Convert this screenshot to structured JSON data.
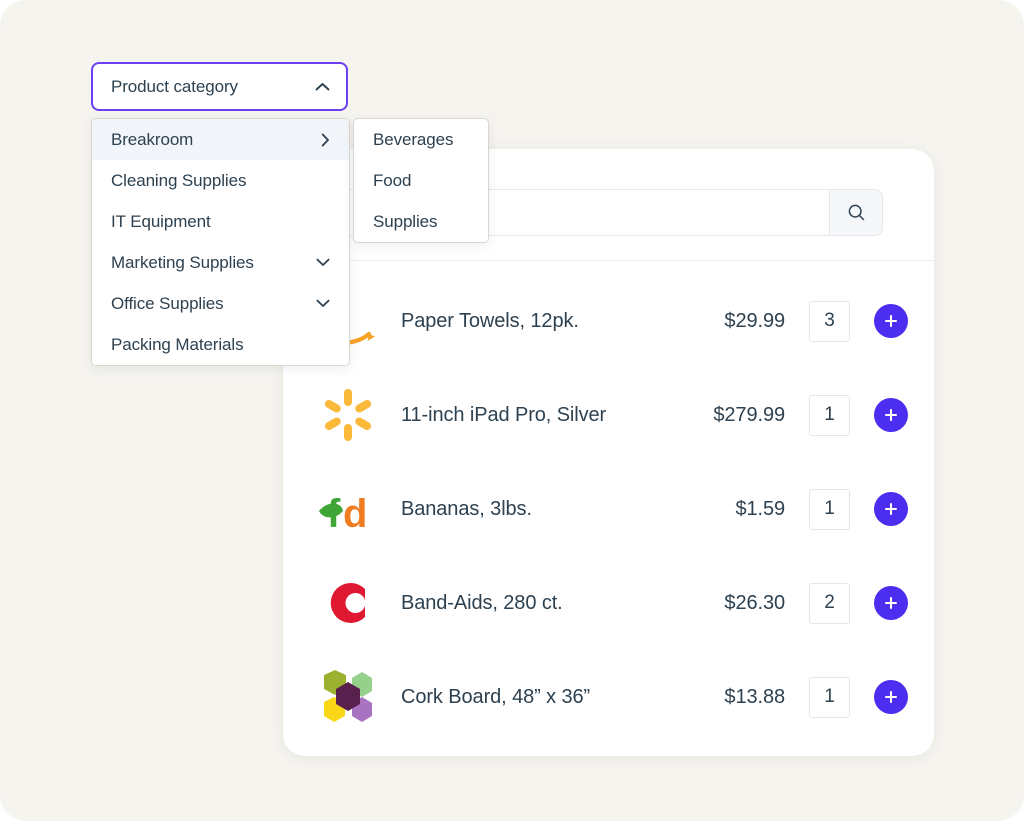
{
  "theme": {
    "page_background": "#f6f4ef",
    "card_background": "#ffffff",
    "accent": "#4b2eef",
    "focus_border": "#6c3ff0",
    "text": "#2d4150",
    "menu_highlight": "#f2f5f9"
  },
  "category_dropdown": {
    "label": "Product category",
    "expanded": true,
    "chevron_icon": "chevron-up-icon",
    "items": [
      {
        "label": "Breakroom",
        "affordance": "chevron-right-icon",
        "highlighted": true
      },
      {
        "label": "Cleaning Supplies",
        "affordance": "",
        "highlighted": false
      },
      {
        "label": "IT Equipment",
        "affordance": "",
        "highlighted": false
      },
      {
        "label": "Marketing Supplies",
        "affordance": "chevron-down-icon",
        "highlighted": false
      },
      {
        "label": "Office Supplies",
        "affordance": "chevron-down-icon",
        "highlighted": false
      },
      {
        "label": "Packing Materials",
        "affordance": "",
        "highlighted": false
      }
    ],
    "submenu": {
      "parent": "Breakroom",
      "items": [
        {
          "label": "Beverages"
        },
        {
          "label": "Food"
        },
        {
          "label": "Supplies"
        }
      ]
    }
  },
  "search": {
    "value": "",
    "placeholder": "",
    "button_icon": "search-icon"
  },
  "products": [
    {
      "vendor_logo": "amazon-logo",
      "name": "Paper Towels, 12pk.",
      "price": "$29.99",
      "quantity": "3",
      "add_icon": "plus-icon"
    },
    {
      "vendor_logo": "walmart-logo",
      "name": "11-inch iPad Pro, Silver",
      "price": "$279.99",
      "quantity": "1",
      "add_icon": "plus-icon"
    },
    {
      "vendor_logo": "freshdirect-logo",
      "name": "Bananas, 3lbs.",
      "price": "$1.59",
      "quantity": "1",
      "add_icon": "plus-icon"
    },
    {
      "vendor_logo": "red-c-logo",
      "name": "Band-Aids, 280 ct.",
      "price": "$26.30",
      "quantity": "2",
      "add_icon": "plus-icon"
    },
    {
      "vendor_logo": "hexagons-logo",
      "name": "Cork Board, 48” x 36”",
      "price": "$13.88",
      "quantity": "1",
      "add_icon": "plus-icon"
    }
  ]
}
